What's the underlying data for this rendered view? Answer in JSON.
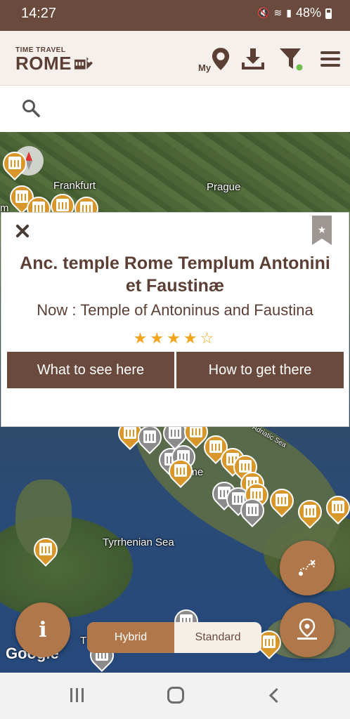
{
  "status_bar": {
    "time": "14:27",
    "battery": "48%"
  },
  "header": {
    "logo_small": "TIME TRAVEL",
    "logo_big": "ROME",
    "my_label": "My"
  },
  "map": {
    "labels": {
      "frankfurt": "Frankfurt",
      "prague": "Prague",
      "adriatic": "Adriatic Sea",
      "rome": "ome",
      "tyrrhenian": "Tyrrhenian Sea",
      "google": "Google",
      "edge_t": "T",
      "edge_m": "m"
    }
  },
  "popup": {
    "title": "Anc. temple Rome Templum Antonini et Faustinæ",
    "now": "Now :  Temple of Antoninus and Faustina",
    "rating_stars": 4,
    "rating_max": 5,
    "btn_see": "What to see here",
    "btn_get": "How to get there"
  },
  "controls": {
    "info_label": "i",
    "map_type_options": [
      "Hybrid",
      "Standard"
    ],
    "map_type_selected": "Hybrid"
  },
  "colors": {
    "brand_brown": "#6b4a3e",
    "accent_gold": "#b0784a",
    "star": "#f3a51c",
    "filter_dot": "#6cc04a"
  },
  "icons": {
    "my_location": "map-pin-icon",
    "download": "download-icon",
    "filter": "filter-icon",
    "menu": "hamburger-menu-icon",
    "search": "search-icon",
    "close": "close-icon",
    "bookmark": "bookmark-star-icon",
    "tour": "tour-map-icon",
    "locate": "locate-pin-icon"
  }
}
